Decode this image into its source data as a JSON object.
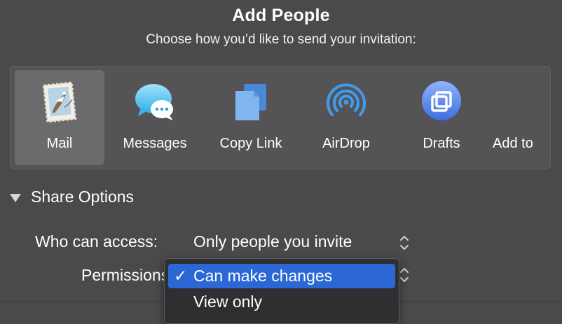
{
  "dialog": {
    "title": "Add People",
    "subtitle": "Choose how you’d like to send your invitation:"
  },
  "share_methods": [
    {
      "label": "Mail",
      "icon": "mail-stamp-icon",
      "selected": true
    },
    {
      "label": "Messages",
      "icon": "messages-bubble-icon",
      "selected": false
    },
    {
      "label": "Copy Link",
      "icon": "copy-link-icon",
      "selected": false
    },
    {
      "label": "AirDrop",
      "icon": "airdrop-icon",
      "selected": false
    },
    {
      "label": "Drafts",
      "icon": "drafts-icon",
      "selected": false
    },
    {
      "label": "Add to",
      "icon": "",
      "selected": false
    }
  ],
  "share_options": {
    "header": "Share Options",
    "access_label": "Who can access:",
    "access_value": "Only people you invite",
    "permissions_label": "Permissions:"
  },
  "permissions_menu": {
    "check_glyph": "✓",
    "options": [
      {
        "label": "Can make changes",
        "checked": true,
        "highlighted": true
      },
      {
        "label": "View only",
        "checked": false,
        "highlighted": false
      }
    ]
  },
  "colors": {
    "background": "#4a4a4c",
    "menu_highlight": "#2c67d6",
    "panel": "#545456"
  }
}
